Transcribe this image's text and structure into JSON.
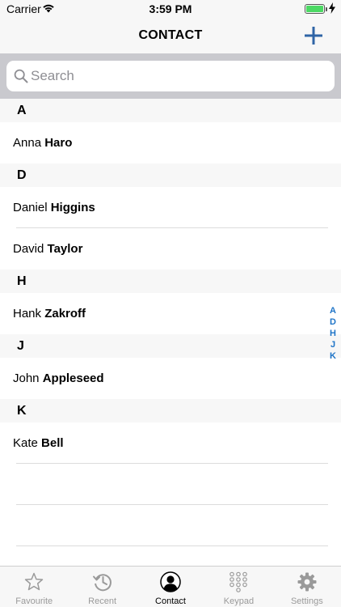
{
  "status_bar": {
    "carrier": "Carrier",
    "time": "3:59 PM"
  },
  "nav": {
    "title": "CONTACT",
    "add_icon": "plus-icon"
  },
  "search": {
    "placeholder": "Search",
    "value": ""
  },
  "sections": [
    {
      "letter": "A",
      "contacts": [
        {
          "first": "Anna",
          "last": "Haro"
        }
      ]
    },
    {
      "letter": "D",
      "contacts": [
        {
          "first": "Daniel",
          "last": "Higgins"
        },
        {
          "first": "David",
          "last": "Taylor"
        }
      ]
    },
    {
      "letter": "H",
      "contacts": [
        {
          "first": "Hank",
          "last": "Zakroff"
        }
      ]
    },
    {
      "letter": "J",
      "contacts": [
        {
          "first": "John",
          "last": "Appleseed"
        }
      ]
    },
    {
      "letter": "K",
      "contacts": [
        {
          "first": "Kate",
          "last": "Bell"
        }
      ]
    }
  ],
  "index_letters": [
    "A",
    "D",
    "H",
    "J",
    "K"
  ],
  "tabs": [
    {
      "label": "Favourite",
      "icon": "star-icon"
    },
    {
      "label": "Recent",
      "icon": "history-icon"
    },
    {
      "label": "Contact",
      "icon": "person-icon",
      "active": true
    },
    {
      "label": "Keypad",
      "icon": "keypad-icon"
    },
    {
      "label": "Settings",
      "icon": "gear-icon"
    }
  ],
  "colors": {
    "accent": "#1e74c7",
    "battery": "#4cd964",
    "tab_inactive": "#9a9a9a"
  }
}
